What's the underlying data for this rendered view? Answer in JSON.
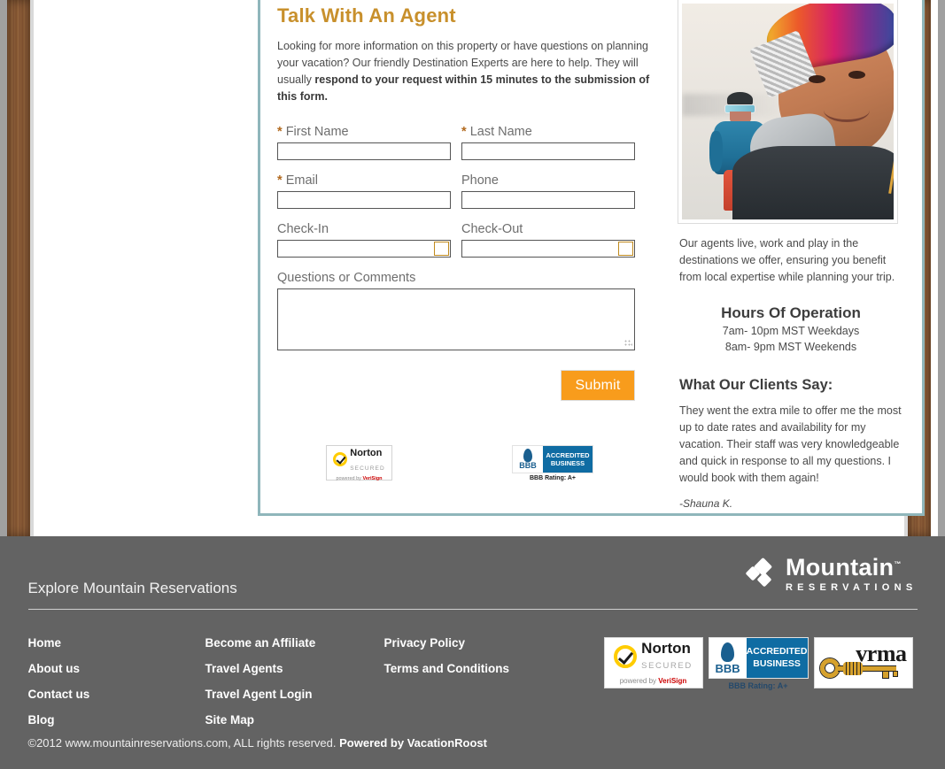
{
  "form": {
    "title": "Talk With An Agent",
    "intro_normal_1": "Looking for more information on this property or have questions on planning your vacation? Our friendly Destination Experts are here to help. They will usually ",
    "intro_bold": "respond to your request within 15 minutes to the submission of this form.",
    "fields": {
      "first_name": {
        "label": "First Name",
        "required_mark": "*",
        "value": ""
      },
      "last_name": {
        "label": "Last Name",
        "required_mark": "*",
        "value": ""
      },
      "email": {
        "label": "Email",
        "required_mark": "*",
        "value": ""
      },
      "phone": {
        "label": "Phone",
        "value": ""
      },
      "check_in": {
        "label": "Check-In",
        "value": ""
      },
      "check_out": {
        "label": "Check-Out",
        "value": ""
      },
      "comments": {
        "label": "Questions or Comments",
        "value": ""
      }
    },
    "submit_label": "Submit",
    "badges": {
      "norton": {
        "title": "Norton",
        "subtitle": "SECURED",
        "powered_prefix": "powered by ",
        "powered_brand": "VeriSign"
      },
      "bbb": {
        "line1": "ACCREDITED",
        "line2": "BUSINESS",
        "mark": "BBB",
        "rating": "BBB Rating: A+"
      }
    }
  },
  "sidebar": {
    "photo_alt": "two-skiers-in-snow-photo",
    "blurb": "Our agents live, work and play in the destinations we offer, ensuring you benefit from local expertise while planning your trip.",
    "hours_title": "Hours Of Operation",
    "hours_weekdays": "7am- 10pm MST Weekdays",
    "hours_weekends": "8am- 9pm MST Weekends",
    "clients_title": "What Our Clients Say:",
    "testimonial": "They went the extra mile to offer me the most up to date rates and availability for my vacation. Their staff was very knowledgeable and quick in response to all my questions. I would book with them again!",
    "testimonial_author": "-Shauna K."
  },
  "footer": {
    "heading": "Explore Mountain Reservations",
    "logo": {
      "main": "Mountain",
      "tm": "™",
      "sub": "RESERVATIONS"
    },
    "columns": [
      {
        "links": [
          "Home",
          "About us",
          "Contact us",
          "Blog"
        ]
      },
      {
        "links": [
          "Become an Affiliate",
          "Travel Agents",
          "Travel Agent Login",
          "Site Map"
        ]
      },
      {
        "links": [
          "Privacy Policy",
          "Terms and Conditions"
        ]
      }
    ],
    "badges": {
      "norton": {
        "title": "Norton",
        "subtitle": "SECURED",
        "powered_prefix": "powered by ",
        "powered_brand": "VeriSign"
      },
      "bbb": {
        "line1": "ACCREDITED",
        "line2": "BUSINESS",
        "mark": "BBB",
        "rating": "BBB Rating: A+"
      },
      "vrma": {
        "title": "vrma"
      }
    },
    "copyright_normal": "©2012 www.mountainreservations.com, ALL rights reserved. ",
    "copyright_bold": "Powered by VacationRoost"
  },
  "colors": {
    "accent_gold": "#c8902c",
    "submit_orange": "#f89c1c",
    "panel_border": "#8fb6bb",
    "footer_bg": "#636363"
  }
}
